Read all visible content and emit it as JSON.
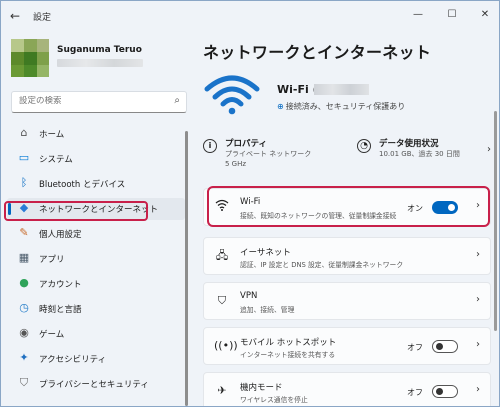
{
  "window": {
    "title": "設定"
  },
  "user": {
    "name": "Suganuma Teruo"
  },
  "search": {
    "placeholder": "設定の検索"
  },
  "sidebar": {
    "items": [
      {
        "label": "ホーム",
        "icon": "home-icon",
        "glyph": "⌂"
      },
      {
        "label": "システム",
        "icon": "system-icon",
        "glyph": "▭"
      },
      {
        "label": "Bluetooth とデバイス",
        "icon": "bluetooth-icon",
        "glyph": "ᛒ"
      },
      {
        "label": "ネットワークとインターネット",
        "icon": "network-icon",
        "glyph": "◆"
      },
      {
        "label": "個人用設定",
        "icon": "personalization-icon",
        "glyph": "✎"
      },
      {
        "label": "アプリ",
        "icon": "apps-icon",
        "glyph": "▦"
      },
      {
        "label": "アカウント",
        "icon": "account-icon",
        "glyph": "●"
      },
      {
        "label": "時刻と言語",
        "icon": "time-language-icon",
        "glyph": "◷"
      },
      {
        "label": "ゲーム",
        "icon": "gaming-icon",
        "glyph": "◉"
      },
      {
        "label": "アクセシビリティ",
        "icon": "accessibility-icon",
        "glyph": "✦"
      },
      {
        "label": "プライバシーとセキュリティ",
        "icon": "privacy-shield-icon",
        "glyph": "⛉"
      }
    ]
  },
  "main": {
    "title": "ネットワークとインターネット",
    "hero": {
      "name": "Wi-Fi (",
      "status": "接続済み、セキュリティ保護あり"
    },
    "properties": {
      "title": "プロパティ",
      "line1": "プライベート ネットワーク",
      "line2": "5 GHz"
    },
    "data_usage": {
      "title": "データ使用状況",
      "line1": "10.01 GB、過去 30 日間"
    },
    "cards": {
      "wifi": {
        "title": "Wi-Fi",
        "subtitle": "接続、既知のネットワークの管理、従量制課金接続",
        "state": "オン",
        "on": true
      },
      "ethernet": {
        "title": "イーサネット",
        "subtitle": "認証、IP 設定と DNS 設定、従量制課金ネットワーク"
      },
      "vpn": {
        "title": "VPN",
        "subtitle": "追加、接続、管理"
      },
      "hotspot": {
        "title": "モバイル ホットスポット",
        "subtitle": "インターネット接続を共有する",
        "state": "オフ",
        "on": false
      },
      "airplane": {
        "title": "機内モード",
        "subtitle": "ワイヤレス通信を停止",
        "state": "オフ",
        "on": false
      }
    }
  },
  "colors": {
    "accent": "#0067c0",
    "highlight": "#c8204a"
  }
}
